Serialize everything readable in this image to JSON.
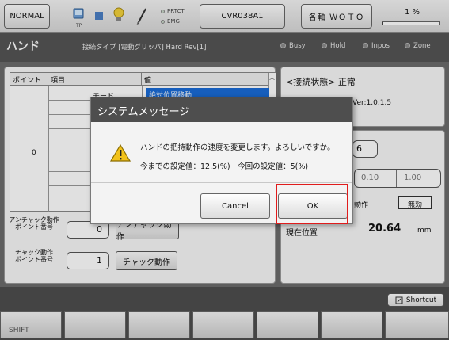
{
  "topbar": {
    "mode_label": "NORMAL",
    "pendant_sub": "TP",
    "prtct_label": "PRTCT",
    "emg_label": "EMG",
    "device_id": "CVR038A1",
    "axis_label": "各軸 ＷＯＴＯ",
    "speed_percent": "1 %",
    "speed_fraction": 0.01
  },
  "titlebar": {
    "title": "ハンド",
    "connection": "接続タイプ [電動グリッパ]  Hard Rev[1]",
    "indicators": [
      "Busy",
      "Hold",
      "Inpos",
      "Zone"
    ]
  },
  "grid": {
    "headers": [
      "ポイント",
      "項目",
      "値"
    ],
    "mode_label": "モード",
    "mode_value": "絶対位置移動",
    "point_no": "0"
  },
  "left_bottom": {
    "unchuck_label_line1": "アンチャック動作",
    "unchuck_label_line2": "ポイント番号",
    "unchuck_value": "0",
    "unchuck_button": "アンチャック動作",
    "chuck_label_line1": "チャック動作",
    "chuck_label_line2": "ポイント番号",
    "chuck_value": "1",
    "chuck_button": "チャック動作"
  },
  "right": {
    "status_heading": "<接続状態> 正常",
    "version_partial": "Ver:1.0.1.5",
    "speed_digit": "6",
    "step_options": [
      "0.10",
      "1.00"
    ],
    "servo_label": "動作",
    "servo_value": "無効",
    "position_label": "現在位置",
    "position_value": "20.64",
    "position_unit": "mm"
  },
  "dialog": {
    "title": "システムメッセージ",
    "message1": "ハンドの把持動作の速度を変更します。よろしいですか。",
    "message2": "今までの設定値：12.5(%)　今回の設定値：5(%)",
    "cancel_label": "Cancel",
    "ok_label": "OK"
  },
  "bottom": {
    "shortcut_label": "Shortcut",
    "fkeys": [
      "SHIFT",
      "",
      "",
      "",
      "",
      "",
      "",
      ""
    ]
  },
  "colors": {
    "selection_blue": "#1a6cd8",
    "highlight_red": "#e01c1c",
    "warning_yellow": "#f2c21a"
  }
}
